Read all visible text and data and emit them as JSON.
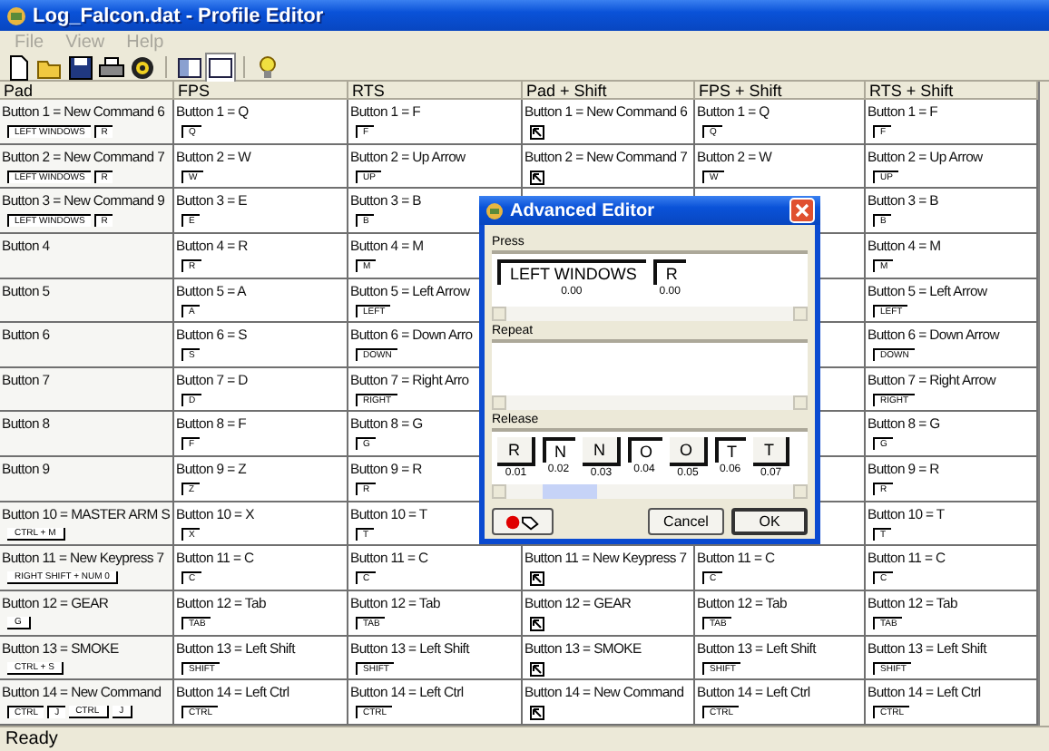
{
  "window": {
    "title": "Log_Falcon.dat - Profile Editor"
  },
  "menu": [
    {
      "label": "File",
      "disabled": true
    },
    {
      "label": "View",
      "disabled": true
    },
    {
      "label": "Help",
      "disabled": true
    }
  ],
  "toolbar": [
    {
      "kind": "new"
    },
    {
      "kind": "open"
    },
    {
      "kind": "save"
    },
    {
      "kind": "print"
    },
    {
      "kind": "target"
    },
    {
      "kind": "sep"
    },
    {
      "kind": "split",
      "selected": false
    },
    {
      "kind": "single",
      "selected": true
    },
    {
      "kind": "sep"
    },
    {
      "kind": "help"
    }
  ],
  "table": {
    "columns": [
      "Pad",
      "FPS",
      "RTS",
      "Pad + Shift",
      "FPS + Shift",
      "RTS + Shift"
    ],
    "rows": [
      [
        {
          "text": "Button 1 = New Command 6",
          "keys": [
            {
              "label": "LEFT WINDOWS",
              "kind": "press"
            },
            {
              "label": "R",
              "kind": "press"
            }
          ]
        },
        {
          "text": "Button 1 = Q",
          "keys": [
            {
              "label": "Q",
              "kind": "press"
            }
          ]
        },
        {
          "text": "Button 1 = F",
          "keys": [
            {
              "label": "F",
              "kind": "press"
            }
          ]
        },
        {
          "text": "Button 1 = New Command 6",
          "kind": "macro"
        },
        {
          "text": "Button 1 = Q",
          "keys": [
            {
              "label": "Q",
              "kind": "press"
            }
          ]
        },
        {
          "text": "Button 1 = F",
          "keys": [
            {
              "label": "F",
              "kind": "press"
            }
          ]
        }
      ],
      [
        {
          "text": "Button 2 = New Command 7",
          "keys": [
            {
              "label": "LEFT WINDOWS",
              "kind": "press"
            },
            {
              "label": "R",
              "kind": "press"
            }
          ]
        },
        {
          "text": "Button 2 = W",
          "keys": [
            {
              "label": "W",
              "kind": "press"
            }
          ]
        },
        {
          "text": "Button 2 = Up Arrow",
          "keys": [
            {
              "label": "UP",
              "kind": "press"
            }
          ]
        },
        {
          "text": "Button 2 = New Command 7",
          "kind": "macro"
        },
        {
          "text": "Button 2 = W",
          "keys": [
            {
              "label": "W",
              "kind": "press"
            }
          ]
        },
        {
          "text": "Button 2 = Up Arrow",
          "keys": [
            {
              "label": "UP",
              "kind": "press"
            }
          ]
        }
      ],
      [
        {
          "text": "Button 3 = New Command 9",
          "keys": [
            {
              "label": "LEFT WINDOWS",
              "kind": "press"
            },
            {
              "label": "R",
              "kind": "press"
            }
          ]
        },
        {
          "text": "Button 3 = E",
          "keys": [
            {
              "label": "E",
              "kind": "press"
            }
          ]
        },
        {
          "text": "Button 3 = B",
          "keys": [
            {
              "label": "B",
              "kind": "press"
            }
          ]
        },
        null,
        null,
        {
          "text": "Button 3 = B",
          "keys": [
            {
              "label": "B",
              "kind": "press"
            }
          ]
        }
      ],
      [
        {
          "text": "Button 4"
        },
        {
          "text": "Button 4 = R",
          "keys": [
            {
              "label": "R",
              "kind": "press"
            }
          ]
        },
        {
          "text": "Button 4 = M",
          "keys": [
            {
              "label": "M",
              "kind": "press"
            }
          ]
        },
        null,
        null,
        {
          "text": "Button 4 = M",
          "keys": [
            {
              "label": "M",
              "kind": "press"
            }
          ]
        }
      ],
      [
        {
          "text": "Button 5"
        },
        {
          "text": "Button 5 = A",
          "keys": [
            {
              "label": "A",
              "kind": "press"
            }
          ]
        },
        {
          "text": "Button 5 = Left Arrow",
          "keys": [
            {
              "label": "LEFT",
              "kind": "press"
            }
          ]
        },
        null,
        null,
        {
          "text": "Button 5 = Left Arrow",
          "keys": [
            {
              "label": "LEFT",
              "kind": "press"
            }
          ]
        }
      ],
      [
        {
          "text": "Button 6"
        },
        {
          "text": "Button 6 = S",
          "keys": [
            {
              "label": "S",
              "kind": "press"
            }
          ]
        },
        {
          "text": "Button 6 = Down Arro",
          "keys": [
            {
              "label": "DOWN",
              "kind": "press"
            }
          ]
        },
        null,
        null,
        {
          "text": "Button 6 = Down Arrow",
          "keys": [
            {
              "label": "DOWN",
              "kind": "press"
            }
          ]
        }
      ],
      [
        {
          "text": "Button 7"
        },
        {
          "text": "Button 7 = D",
          "keys": [
            {
              "label": "D",
              "kind": "press"
            }
          ]
        },
        {
          "text": "Button 7 = Right Arro",
          "keys": [
            {
              "label": "RIGHT",
              "kind": "press"
            }
          ]
        },
        null,
        null,
        {
          "text": "Button 7 = Right Arrow",
          "keys": [
            {
              "label": "RIGHT",
              "kind": "press"
            }
          ]
        }
      ],
      [
        {
          "text": "Button 8"
        },
        {
          "text": "Button 8 = F",
          "keys": [
            {
              "label": "F",
              "kind": "press"
            }
          ]
        },
        {
          "text": "Button 8 = G",
          "keys": [
            {
              "label": "G",
              "kind": "press"
            }
          ]
        },
        null,
        null,
        {
          "text": "Button 8 = G",
          "keys": [
            {
              "label": "G",
              "kind": "press"
            }
          ]
        }
      ],
      [
        {
          "text": "Button 9"
        },
        {
          "text": "Button 9 = Z",
          "keys": [
            {
              "label": "Z",
              "kind": "press"
            }
          ]
        },
        {
          "text": "Button 9 = R",
          "keys": [
            {
              "label": "R",
              "kind": "press"
            }
          ]
        },
        null,
        null,
        {
          "text": "Button 9 = R",
          "keys": [
            {
              "label": "R",
              "kind": "press"
            }
          ]
        }
      ],
      [
        {
          "text": "Button 10 = MASTER ARM S",
          "keys": [
            {
              "label": "CTRL + M",
              "kind": "release"
            }
          ]
        },
        {
          "text": "Button 10 = X",
          "keys": [
            {
              "label": "X",
              "kind": "press"
            }
          ]
        },
        {
          "text": "Button 10 = T",
          "keys": [
            {
              "label": "T",
              "kind": "press"
            }
          ]
        },
        null,
        null,
        {
          "text": "Button 10 = T",
          "keys": [
            {
              "label": "T",
              "kind": "press"
            }
          ]
        }
      ],
      [
        {
          "text": "Button 11 = New Keypress 7",
          "keys": [
            {
              "label": "RIGHT SHIFT + NUM 0",
              "kind": "release"
            }
          ]
        },
        {
          "text": "Button 11 = C",
          "keys": [
            {
              "label": "C",
              "kind": "press"
            }
          ]
        },
        {
          "text": "Button 11 = C",
          "keys": [
            {
              "label": "C",
              "kind": "press"
            }
          ]
        },
        {
          "text": "Button 11 = New Keypress 7",
          "kind": "macro"
        },
        {
          "text": "Button 11 = C",
          "keys": [
            {
              "label": "C",
              "kind": "press"
            }
          ]
        },
        {
          "text": "Button 11 = C",
          "keys": [
            {
              "label": "C",
              "kind": "press"
            }
          ]
        }
      ],
      [
        {
          "text": "Button 12 = GEAR",
          "keys": [
            {
              "label": "G",
              "kind": "release"
            }
          ]
        },
        {
          "text": "Button 12 = Tab",
          "keys": [
            {
              "label": "TAB",
              "kind": "press"
            }
          ]
        },
        {
          "text": "Button 12 = Tab",
          "keys": [
            {
              "label": "TAB",
              "kind": "press"
            }
          ]
        },
        {
          "text": "Button 12 = GEAR",
          "kind": "macro"
        },
        {
          "text": "Button 12 = Tab",
          "keys": [
            {
              "label": "TAB",
              "kind": "press"
            }
          ]
        },
        {
          "text": "Button 12 = Tab",
          "keys": [
            {
              "label": "TAB",
              "kind": "press"
            }
          ]
        }
      ],
      [
        {
          "text": "Button 13 = SMOKE",
          "keys": [
            {
              "label": "CTRL + S",
              "kind": "release"
            }
          ]
        },
        {
          "text": "Button 13 = Left Shift",
          "keys": [
            {
              "label": "SHIFT",
              "kind": "press"
            }
          ]
        },
        {
          "text": "Button 13 = Left Shift",
          "keys": [
            {
              "label": "SHIFT",
              "kind": "press"
            }
          ]
        },
        {
          "text": "Button 13 = SMOKE",
          "kind": "macro"
        },
        {
          "text": "Button 13 = Left Shift",
          "keys": [
            {
              "label": "SHIFT",
              "kind": "press"
            }
          ]
        },
        {
          "text": "Button 13 = Left Shift",
          "keys": [
            {
              "label": "SHIFT",
              "kind": "press"
            }
          ]
        }
      ],
      [
        {
          "text": "Button 14 = New Command",
          "keys": [
            {
              "label": "CTRL",
              "kind": "press"
            },
            {
              "label": "J",
              "kind": "press"
            },
            {
              "label": "CTRL",
              "kind": "release"
            },
            {
              "label": "J",
              "kind": "release"
            }
          ]
        },
        {
          "text": "Button 14 = Left Ctrl",
          "keys": [
            {
              "label": "CTRL",
              "kind": "press"
            }
          ]
        },
        {
          "text": "Button 14 = Left Ctrl",
          "keys": [
            {
              "label": "CTRL",
              "kind": "press"
            }
          ]
        },
        {
          "text": "Button 14 = New Command",
          "kind": "macro"
        },
        {
          "text": "Button 14 = Left Ctrl",
          "keys": [
            {
              "label": "CTRL",
              "kind": "press"
            }
          ]
        },
        {
          "text": "Button 14 = Left Ctrl",
          "keys": [
            {
              "label": "CTRL",
              "kind": "press"
            }
          ]
        }
      ]
    ]
  },
  "dialog": {
    "title": "Advanced Editor",
    "sections": [
      {
        "label": "Press",
        "keys": [
          {
            "label": "LEFT WINDOWS",
            "time": "0.00",
            "kind": "press"
          },
          {
            "label": "R",
            "time": "0.00",
            "kind": "press"
          }
        ]
      },
      {
        "label": "Repeat"
      },
      {
        "label": "Release",
        "keys": [
          {
            "label": "R",
            "time": "0.01",
            "kind": "release"
          },
          {
            "label": "N",
            "time": "0.02",
            "kind": "press"
          },
          {
            "label": "N",
            "time": "0.03",
            "kind": "release"
          },
          {
            "label": "O",
            "time": "0.04",
            "kind": "press"
          },
          {
            "label": "O",
            "time": "0.05",
            "kind": "release"
          },
          {
            "label": "T",
            "time": "0.06",
            "kind": "press"
          },
          {
            "label": "T",
            "time": "0.07",
            "kind": "release"
          }
        ]
      }
    ],
    "buttons": [
      {
        "kind": "record"
      },
      {
        "kind": "text",
        "label": "Cancel",
        "default": false
      },
      {
        "kind": "text",
        "label": "OK",
        "default": true
      }
    ]
  },
  "status_bar": "Ready"
}
